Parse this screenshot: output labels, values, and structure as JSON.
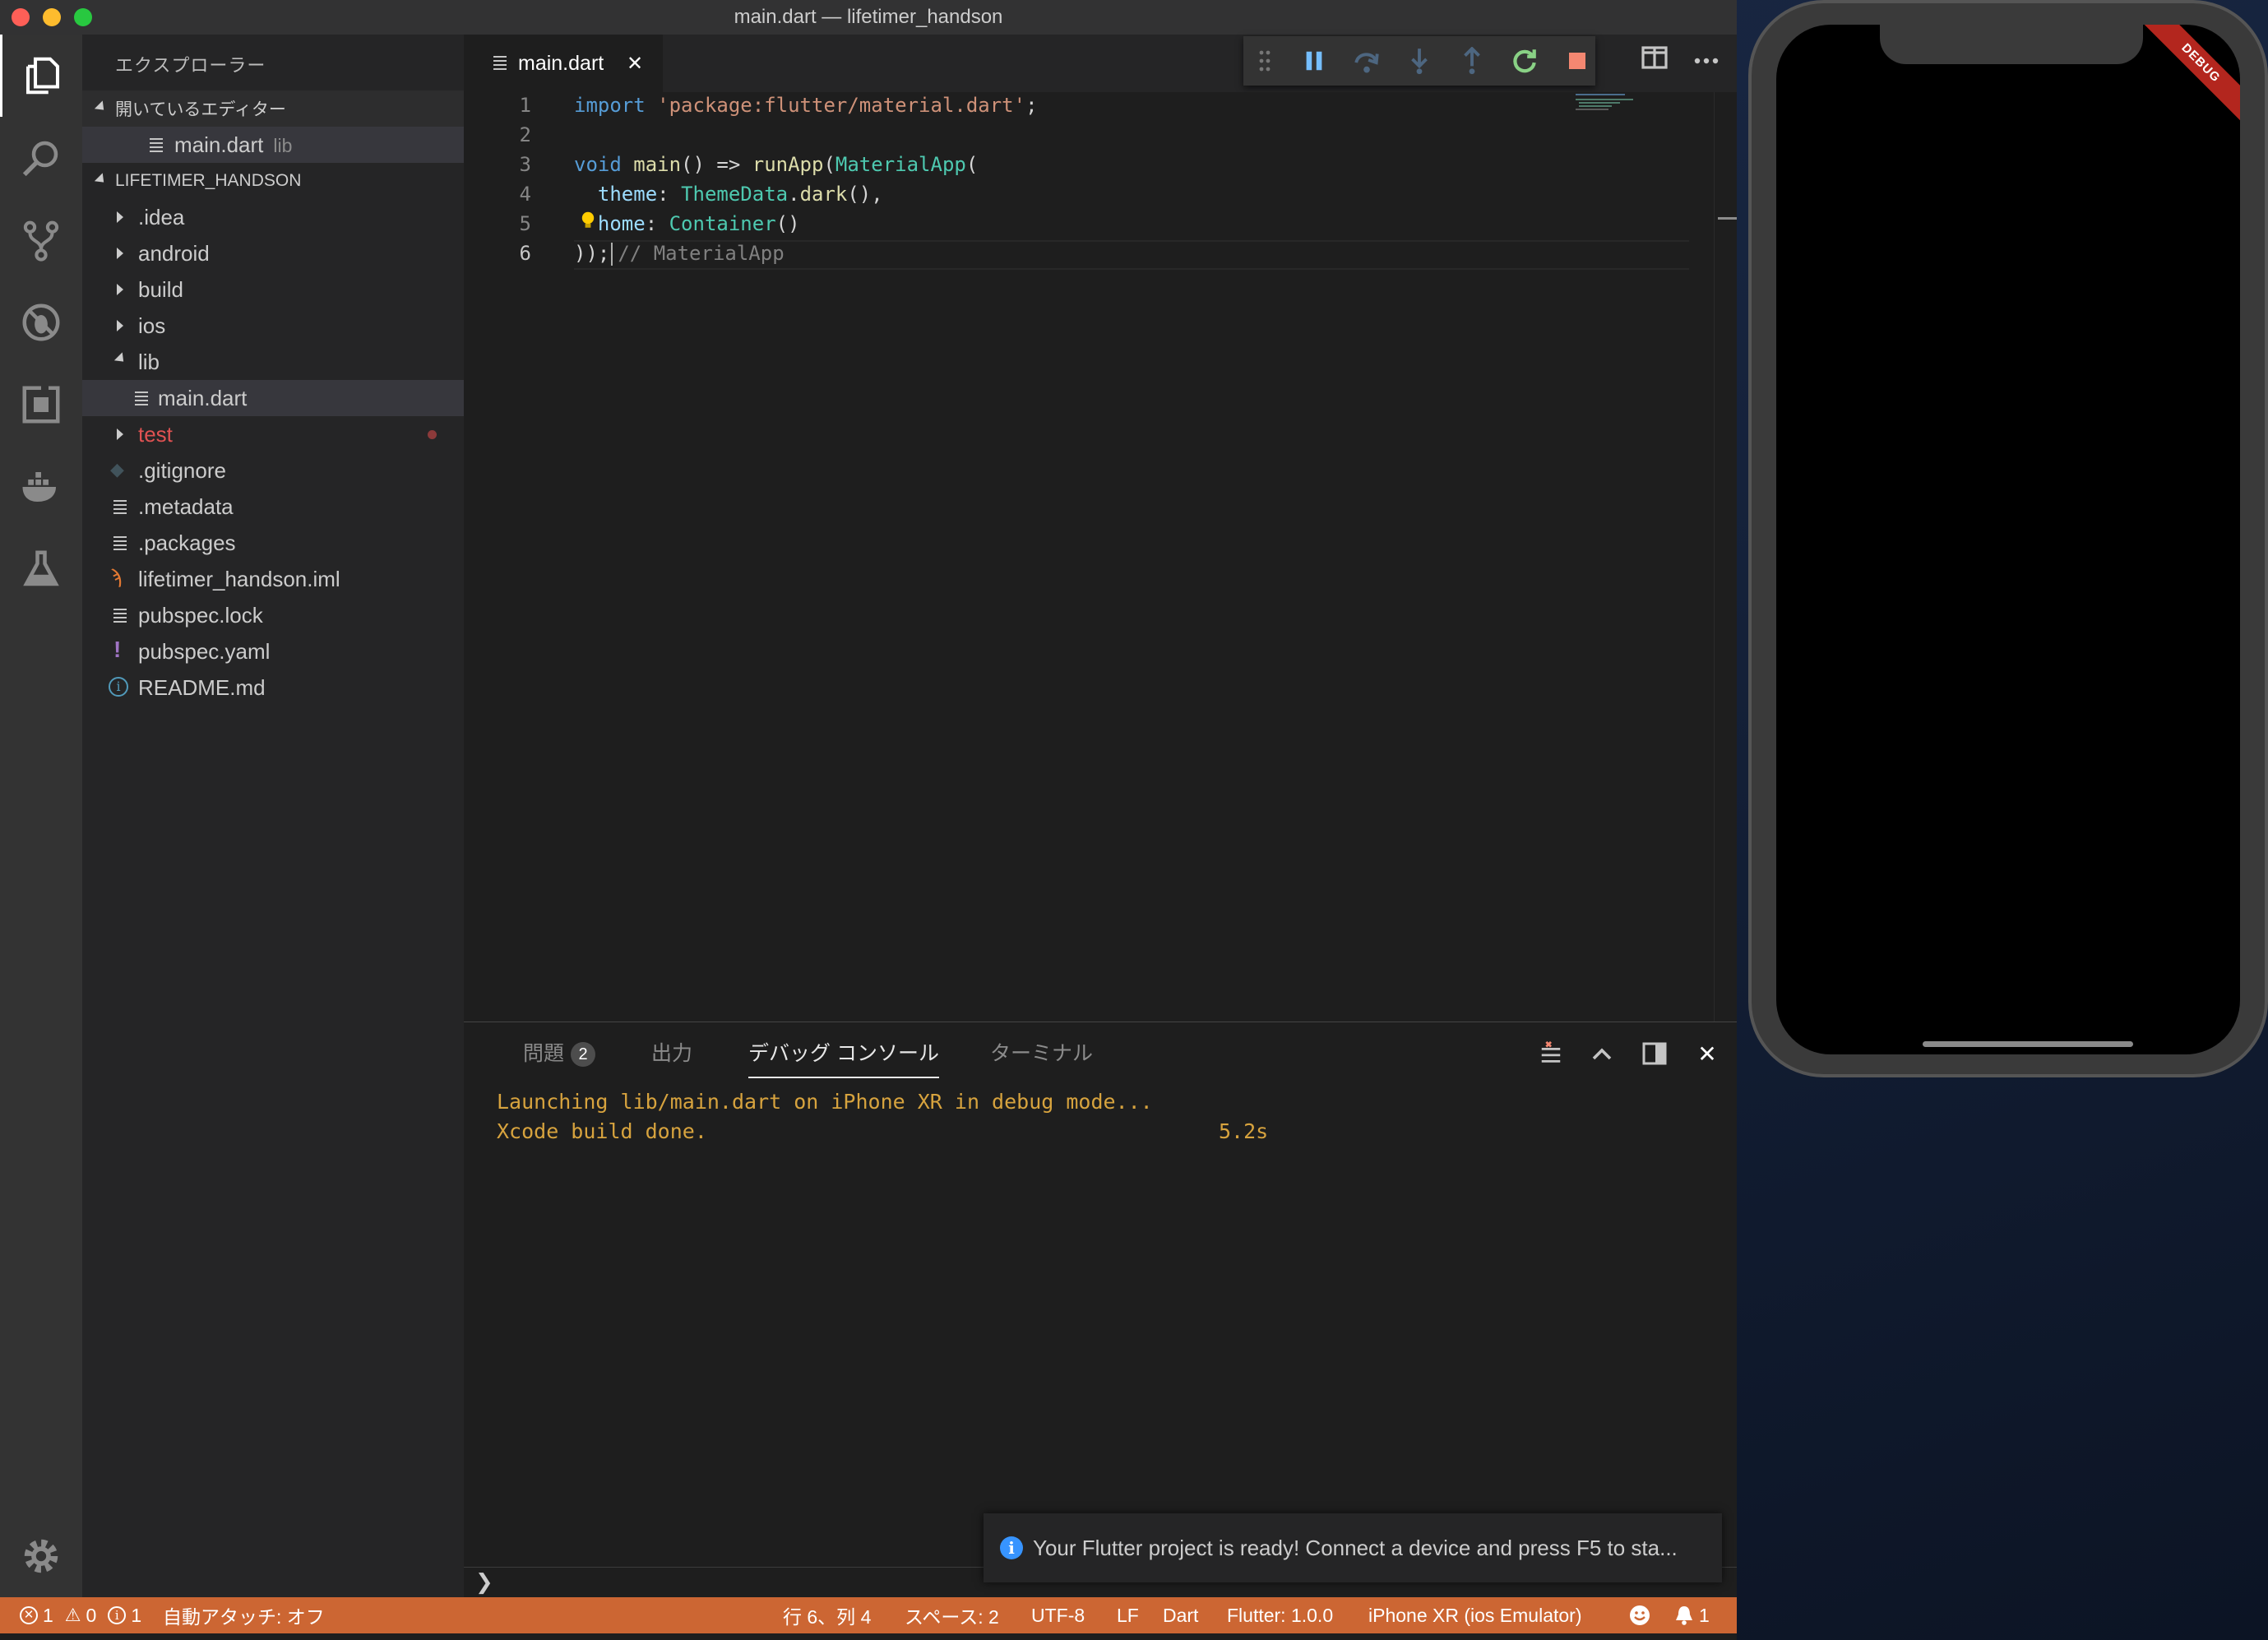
{
  "window": {
    "title": "main.dart — lifetimer_handson"
  },
  "explorer": {
    "title": "エクスプローラー",
    "open_editors": {
      "header": "開いているエディター",
      "items": [
        {
          "name": "main.dart",
          "sub": "lib"
        }
      ]
    },
    "project": {
      "header": "LIFETIMER_HANDSON",
      "items": [
        {
          "name": ".idea",
          "type": "folder"
        },
        {
          "name": "android",
          "type": "folder"
        },
        {
          "name": "build",
          "type": "folder"
        },
        {
          "name": "ios",
          "type": "folder"
        },
        {
          "name": "lib",
          "type": "folder-open"
        },
        {
          "name": "main.dart",
          "type": "file"
        },
        {
          "name": "test",
          "type": "folder",
          "status_color": "#e05252"
        },
        {
          "name": ".gitignore",
          "type": "git-file"
        },
        {
          "name": ".metadata",
          "type": "file"
        },
        {
          "name": ".packages",
          "type": "file"
        },
        {
          "name": "lifetimer_handson.iml",
          "type": "rss-file"
        },
        {
          "name": "pubspec.lock",
          "type": "file"
        },
        {
          "name": "pubspec.yaml",
          "type": "yaml-file"
        },
        {
          "name": "README.md",
          "type": "info-file"
        }
      ]
    }
  },
  "editor": {
    "tab": {
      "label": "main.dart",
      "close": "✕"
    },
    "line_numbers": [
      "1",
      "2",
      "3",
      "4",
      "5",
      "6"
    ],
    "code": {
      "l1_kw": "import",
      "l1_str": "'package:flutter/material.dart'",
      "l1_end": ";",
      "l3_kw": "void",
      "l3_fn": "main",
      "l3_mid": "() => ",
      "l3_fn2": "runApp",
      "l3_p": "(",
      "l3_ty": "MaterialApp",
      "l3_end": "(",
      "l4_prop": "theme",
      "l4_colon": ": ",
      "l4_ty": "ThemeData",
      "l4_dot": ".",
      "l4_fn": "dark",
      "l4_end": "(),",
      "l5_prop": "home",
      "l5_colon": ": ",
      "l5_ty": "Container",
      "l5_end": "()",
      "l6_end": "));",
      "l6_comment": "// MaterialApp"
    },
    "hint_icon": "lightbulb-icon"
  },
  "debug_toolbar": {
    "buttons": [
      "drag-handle-icon",
      "pause-icon",
      "step-over-icon",
      "step-into-icon",
      "step-out-icon",
      "restart-icon",
      "stop-icon"
    ]
  },
  "panel": {
    "tabs": [
      {
        "label": "問題",
        "badge": "2"
      },
      {
        "label": "出力"
      },
      {
        "label": "デバッグ コンソール"
      },
      {
        "label": "ターミナル"
      }
    ],
    "console": [
      {
        "text": "Launching lib/main.dart on iPhone XR in debug mode..."
      },
      {
        "text": "Xcode build done.",
        "time": "5.2s"
      }
    ],
    "repl_prompt": "❯"
  },
  "notification": {
    "text": "Your Flutter project is ready! Connect a device and press F5 to sta..."
  },
  "statusbar": {
    "errors": "1",
    "warnings": "0",
    "infos": "1",
    "auto_attach": "自動アタッチ: オフ",
    "position": "行 6、列 4",
    "spaces": "スペース: 2",
    "encoding": "UTF-8",
    "eol": "LF",
    "language": "Dart",
    "flutter": "Flutter: 1.0.0",
    "device": "iPhone XR (ios Emulator)",
    "notifications": "1"
  },
  "simulator": {
    "banner": "DEBUG"
  },
  "colors": {
    "statusbar": "#cc6633",
    "accent_blue": "#3794ff",
    "console_text": "#d7a33e"
  }
}
